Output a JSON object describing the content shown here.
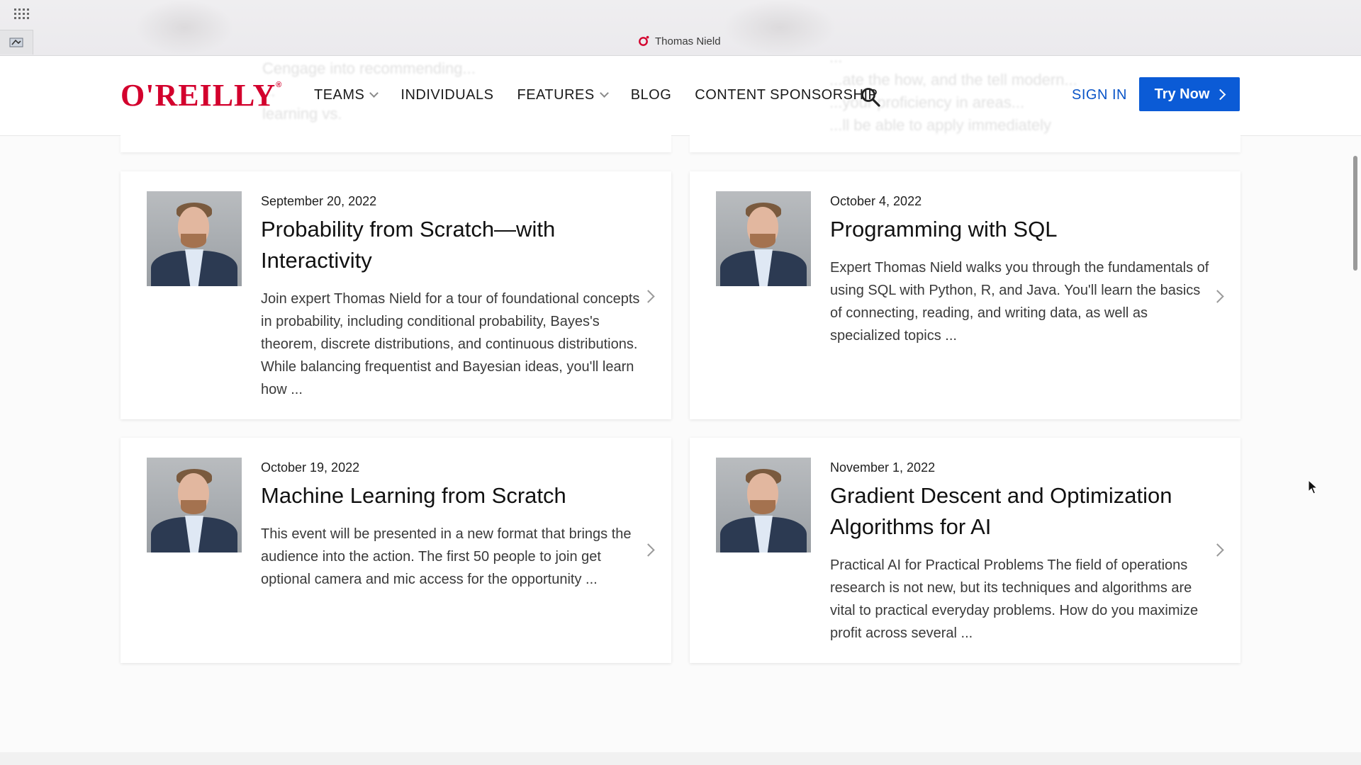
{
  "browser": {
    "tab_title": "Thomas Nield"
  },
  "header": {
    "logo": "O'REILLY",
    "logo_mark": "®",
    "nav": [
      {
        "label": "TEAMS",
        "has_dropdown": true
      },
      {
        "label": "INDIVIDUALS",
        "has_dropdown": false
      },
      {
        "label": "FEATURES",
        "has_dropdown": true
      },
      {
        "label": "BLOG",
        "has_dropdown": false
      },
      {
        "label": "CONTENT SPONSORSHIP",
        "has_dropdown": false
      }
    ],
    "sign_in": "SIGN IN",
    "try_now": "Try Now",
    "ghost_left": [
      "Cengage into recommending...",
      "...",
      "learning vs."
    ],
    "ghost_right": [
      "...",
      "...ate the how, and the tell modern...",
      "...your proficiency in areas...",
      "...ll be able to apply immediately"
    ]
  },
  "colors": {
    "brand_red": "#d3002d",
    "accent_blue": "#0b5bd6",
    "link_blue": "#0a55c8"
  },
  "cards": [
    {
      "date": "September 20, 2022",
      "title": "Probability from Scratch—with Interactivity",
      "description": "Join expert Thomas Nield for a tour of foundational concepts in probability, including conditional probability, Bayes's theorem, discrete distributions, and continuous distributions. While balancing frequentist and Bayesian ideas, you'll learn how ..."
    },
    {
      "date": "October 4, 2022",
      "title": "Programming with SQL",
      "description": "Expert Thomas Nield walks you through the fundamentals of using SQL with Python, R, and Java. You'll learn the basics of connecting, reading, and writing data, as well as specialized topics ..."
    },
    {
      "date": "October 19, 2022",
      "title": "Machine Learning from Scratch",
      "description": "This event will be presented in a new format that brings the audience into the action. The first 50 people to join get optional camera and mic access for the opportunity ..."
    },
    {
      "date": "November 1, 2022",
      "title": "Gradient Descent and Optimization Algorithms for AI",
      "description": "Practical AI for Practical Problems The field of operations research is not new, but its techniques and algorithms are vital to practical everyday problems. How do you maximize profit across several ..."
    }
  ]
}
